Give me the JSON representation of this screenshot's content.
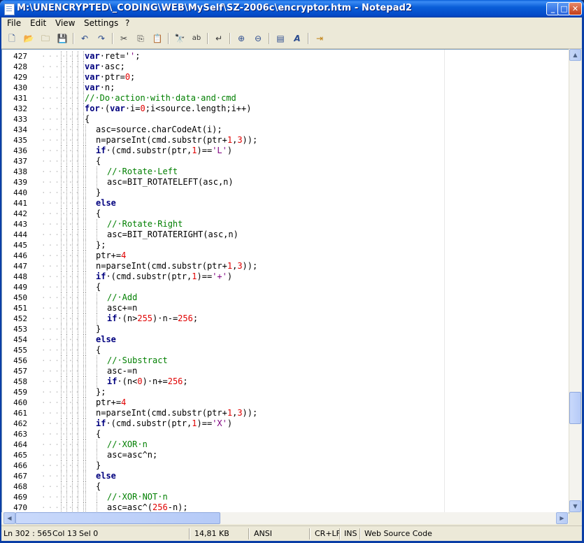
{
  "window": {
    "title": "M:\\UNENCRYPTED\\_CODING\\WEB\\MySelf\\SZ-2006c\\encryptor.htm - Notepad2"
  },
  "menu": [
    "File",
    "Edit",
    "View",
    "Settings",
    "?"
  ],
  "toolbar": [
    "new",
    "open",
    "browse",
    "save",
    "undo",
    "redo",
    "cut",
    "copy",
    "paste",
    "find",
    "replace",
    "wordwrap",
    "zoom-in",
    "zoom-out",
    "view-whitespace",
    "font",
    "exit"
  ],
  "lines": [
    {
      "n": "427",
      "i": 0,
      "t": [
        [
          "kw",
          "var"
        ],
        [
          "",
          "·ret='"
        ],
        [
          "str",
          "'"
        ],
        [
          "",
          ";"
        ]
      ]
    },
    {
      "n": "428",
      "i": 0,
      "t": [
        [
          "kw",
          "var"
        ],
        [
          "",
          "·asc;"
        ]
      ]
    },
    {
      "n": "429",
      "i": 0,
      "t": [
        [
          "kw",
          "var"
        ],
        [
          "",
          "·ptr="
        ],
        [
          "num",
          "0"
        ],
        [
          "",
          ";"
        ]
      ]
    },
    {
      "n": "430",
      "i": 0,
      "t": [
        [
          "kw",
          "var"
        ],
        [
          "",
          "·n;"
        ]
      ]
    },
    {
      "n": "431",
      "i": 0,
      "t": [
        [
          "cm",
          "//·Do·action·with·data·and·cmd"
        ]
      ]
    },
    {
      "n": "432",
      "i": 0,
      "t": [
        [
          "kw",
          "for"
        ],
        [
          "",
          "·("
        ],
        [
          "kw",
          "var"
        ],
        [
          "",
          "·i="
        ],
        [
          "num",
          "0"
        ],
        [
          "",
          ";i<source.length;i++)"
        ]
      ]
    },
    {
      "n": "433",
      "i": 0,
      "t": [
        [
          "",
          "{"
        ]
      ]
    },
    {
      "n": "434",
      "i": 1,
      "t": [
        [
          "",
          "asc=source.charCodeAt(i);"
        ]
      ]
    },
    {
      "n": "435",
      "i": 1,
      "t": [
        [
          "",
          "n=parseInt(cmd.substr(ptr+"
        ],
        [
          "num",
          "1"
        ],
        [
          "",
          ","
        ],
        [
          "num",
          "3"
        ],
        [
          "",
          "));"
        ]
      ]
    },
    {
      "n": "436",
      "i": 1,
      "t": [
        [
          "kw",
          "if"
        ],
        [
          "",
          "·(cmd.substr(ptr,"
        ],
        [
          "num",
          "1"
        ],
        [
          "",
          ")=="
        ],
        [
          "str",
          "'L'"
        ],
        [
          "",
          ")"
        ]
      ]
    },
    {
      "n": "437",
      "i": 1,
      "t": [
        [
          "",
          "{"
        ]
      ]
    },
    {
      "n": "438",
      "i": 2,
      "t": [
        [
          "cm",
          "//·Rotate·Left"
        ]
      ]
    },
    {
      "n": "439",
      "i": 2,
      "t": [
        [
          "",
          "asc=BIT_ROTATELEFT(asc,n)"
        ]
      ]
    },
    {
      "n": "440",
      "i": 1,
      "t": [
        [
          "",
          "}"
        ]
      ]
    },
    {
      "n": "441",
      "i": 1,
      "t": [
        [
          "kw",
          "else"
        ]
      ]
    },
    {
      "n": "442",
      "i": 1,
      "t": [
        [
          "",
          "{"
        ]
      ]
    },
    {
      "n": "443",
      "i": 2,
      "t": [
        [
          "cm",
          "//·Rotate·Right"
        ]
      ]
    },
    {
      "n": "444",
      "i": 2,
      "t": [
        [
          "",
          "asc=BIT_ROTATERIGHT(asc,n)"
        ]
      ]
    },
    {
      "n": "445",
      "i": 1,
      "t": [
        [
          "",
          "};"
        ]
      ]
    },
    {
      "n": "446",
      "i": 1,
      "t": [
        [
          "",
          "ptr+="
        ],
        [
          "num",
          "4"
        ]
      ]
    },
    {
      "n": "447",
      "i": 1,
      "t": [
        [
          "",
          "n=parseInt(cmd.substr(ptr+"
        ],
        [
          "num",
          "1"
        ],
        [
          "",
          ","
        ],
        [
          "num",
          "3"
        ],
        [
          "",
          "));"
        ]
      ]
    },
    {
      "n": "448",
      "i": 1,
      "t": [
        [
          "kw",
          "if"
        ],
        [
          "",
          "·(cmd.substr(ptr,"
        ],
        [
          "num",
          "1"
        ],
        [
          "",
          ")=="
        ],
        [
          "str",
          "'+'"
        ],
        [
          "",
          ")"
        ]
      ]
    },
    {
      "n": "449",
      "i": 1,
      "t": [
        [
          "",
          "{"
        ]
      ]
    },
    {
      "n": "450",
      "i": 2,
      "t": [
        [
          "cm",
          "//·Add"
        ]
      ]
    },
    {
      "n": "451",
      "i": 2,
      "t": [
        [
          "",
          "asc+=n"
        ]
      ]
    },
    {
      "n": "452",
      "i": 2,
      "t": [
        [
          "kw",
          "if"
        ],
        [
          "",
          "·(n>"
        ],
        [
          "num",
          "255"
        ],
        [
          "",
          ")·n-="
        ],
        [
          "num",
          "256"
        ],
        [
          "",
          ";"
        ]
      ]
    },
    {
      "n": "453",
      "i": 1,
      "t": [
        [
          "",
          "}"
        ]
      ]
    },
    {
      "n": "454",
      "i": 1,
      "t": [
        [
          "kw",
          "else"
        ]
      ]
    },
    {
      "n": "455",
      "i": 1,
      "t": [
        [
          "",
          "{"
        ]
      ]
    },
    {
      "n": "456",
      "i": 2,
      "t": [
        [
          "cm",
          "//·Substract"
        ]
      ]
    },
    {
      "n": "457",
      "i": 2,
      "t": [
        [
          "",
          "asc-=n"
        ]
      ]
    },
    {
      "n": "458",
      "i": 2,
      "t": [
        [
          "kw",
          "if"
        ],
        [
          "",
          "·(n<"
        ],
        [
          "num",
          "0"
        ],
        [
          "",
          ")·n+="
        ],
        [
          "num",
          "256"
        ],
        [
          "",
          ";"
        ]
      ]
    },
    {
      "n": "459",
      "i": 1,
      "t": [
        [
          "",
          "};"
        ]
      ]
    },
    {
      "n": "460",
      "i": 1,
      "t": [
        [
          "",
          "ptr+="
        ],
        [
          "num",
          "4"
        ]
      ]
    },
    {
      "n": "461",
      "i": 1,
      "t": [
        [
          "",
          "n=parseInt(cmd.substr(ptr+"
        ],
        [
          "num",
          "1"
        ],
        [
          "",
          ","
        ],
        [
          "num",
          "3"
        ],
        [
          "",
          "));"
        ]
      ]
    },
    {
      "n": "462",
      "i": 1,
      "t": [
        [
          "kw",
          "if"
        ],
        [
          "",
          "·(cmd.substr(ptr,"
        ],
        [
          "num",
          "1"
        ],
        [
          "",
          ")=="
        ],
        [
          "str",
          "'X'"
        ],
        [
          "",
          ")"
        ]
      ]
    },
    {
      "n": "463",
      "i": 1,
      "t": [
        [
          "",
          "{"
        ]
      ]
    },
    {
      "n": "464",
      "i": 2,
      "t": [
        [
          "cm",
          "//·XOR·n"
        ]
      ]
    },
    {
      "n": "465",
      "i": 2,
      "t": [
        [
          "",
          "asc=asc^n;"
        ]
      ]
    },
    {
      "n": "466",
      "i": 1,
      "t": [
        [
          "",
          "}"
        ]
      ]
    },
    {
      "n": "467",
      "i": 1,
      "t": [
        [
          "kw",
          "else"
        ]
      ]
    },
    {
      "n": "468",
      "i": 1,
      "t": [
        [
          "",
          "{"
        ]
      ]
    },
    {
      "n": "469",
      "i": 2,
      "t": [
        [
          "cm",
          "//·XOR·NOT·n"
        ]
      ]
    },
    {
      "n": "470",
      "i": 2,
      "t": [
        [
          "",
          "asc=asc^("
        ],
        [
          "num",
          "256"
        ],
        [
          "",
          "-n);"
        ]
      ]
    }
  ],
  "status": {
    "position": "Ln 302 : 565",
    "col": "Col 13",
    "sel": "Sel 0",
    "size": "14,81 KB",
    "encoding": "ANSI",
    "eol": "CR+LF",
    "ins": "INS",
    "scheme": "Web Source Code"
  },
  "colors": {
    "keyword": "#00007f",
    "comment": "#007f00",
    "number": "#e00000",
    "string": "#7f007f",
    "titlebar": "#0a5fd8"
  }
}
